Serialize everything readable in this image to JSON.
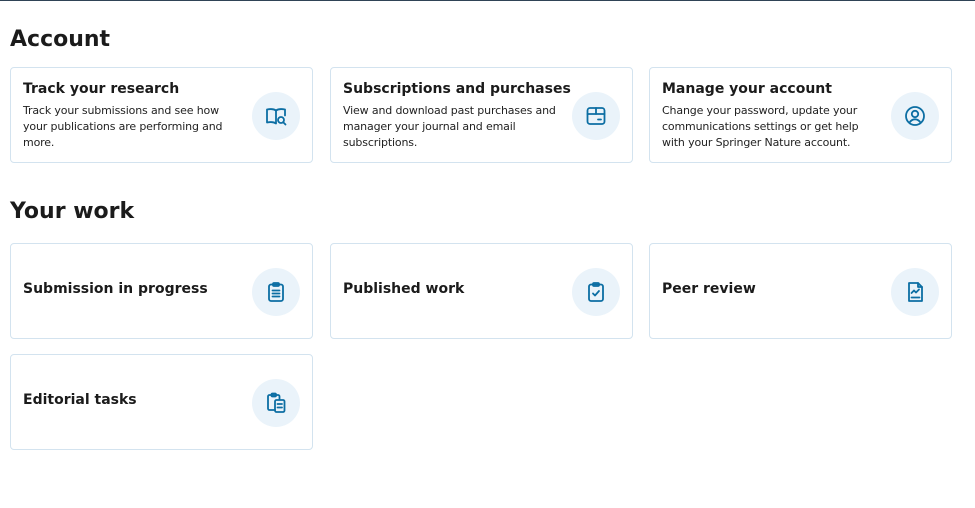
{
  "account": {
    "heading": "Account",
    "cards": [
      {
        "title": "Track your research",
        "description": "Track your submissions and see how your publications are performing and more.",
        "icon": "book-search-icon"
      },
      {
        "title": "Subscriptions and purchases",
        "description": "View and download past purchases and manager your journal and email subscriptions.",
        "icon": "package-icon"
      },
      {
        "title": "Manage your account",
        "description": "Change your password, update your communications settings or get help with your Springer Nature account.",
        "icon": "user-circle-icon"
      }
    ]
  },
  "work": {
    "heading": "Your work",
    "cards": [
      {
        "title": "Submission in progress",
        "icon": "clipboard-list-icon"
      },
      {
        "title": "Published work",
        "icon": "clipboard-check-icon"
      },
      {
        "title": "Peer review",
        "icon": "document-chart-icon"
      },
      {
        "title": "Editorial tasks",
        "icon": "clipboards-icon"
      }
    ]
  },
  "colors": {
    "accent": "#0c6ea3",
    "icon_bg": "#eaf3fa",
    "card_border": "#d3e3ef"
  }
}
